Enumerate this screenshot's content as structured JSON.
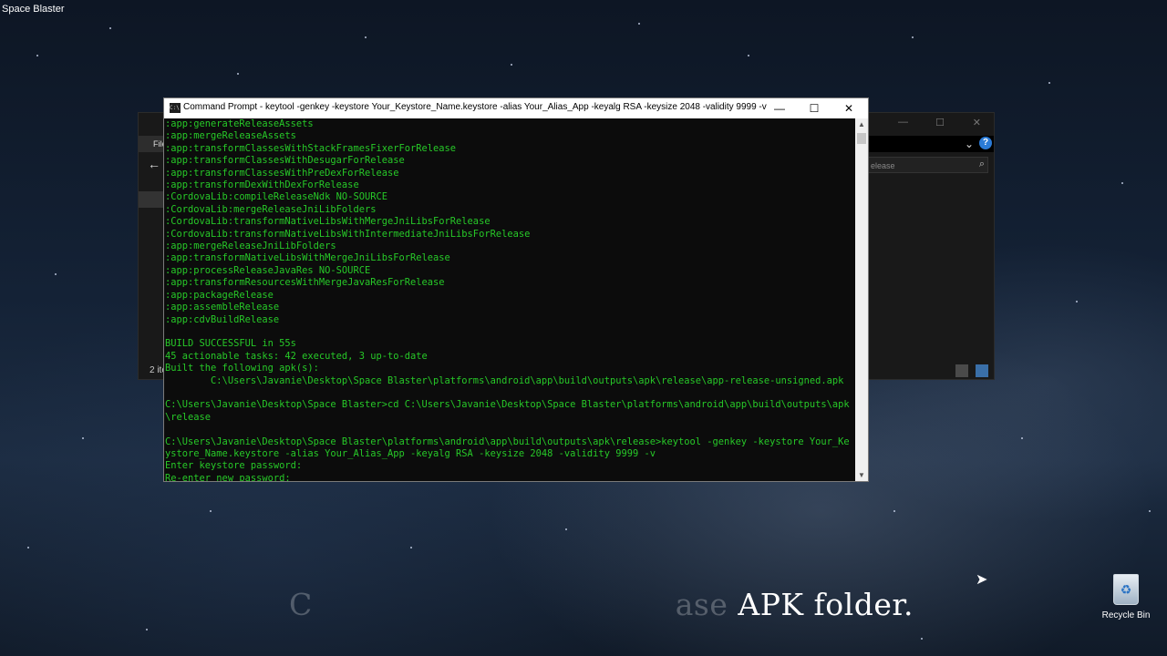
{
  "desktop": {
    "title": "Space Blaster",
    "recycle_bin_label": "Recycle Bin",
    "caption_faded_left": "C",
    "caption_faded_right": "ase",
    "caption_main": " APK folder."
  },
  "explorer": {
    "file_tab": "File",
    "search_placeholder": "elease",
    "status_text": "2 ite",
    "help_label": "?"
  },
  "cmd": {
    "title": "Command Prompt - keytool  -genkey -keystore Your_Keystore_Name.keystore -alias Your_Alias_App -keyalg RSA -keysize 2048 -validity 9999 -v",
    "lines": [
      ":app:generateReleaseAssets",
      ":app:mergeReleaseAssets",
      ":app:transformClassesWithStackFramesFixerForRelease",
      ":app:transformClassesWithDesugarForRelease",
      ":app:transformClassesWithPreDexForRelease",
      ":app:transformDexWithDexForRelease",
      ":CordovaLib:compileReleaseNdk NO-SOURCE",
      ":CordovaLib:mergeReleaseJniLibFolders",
      ":CordovaLib:transformNativeLibsWithMergeJniLibsForRelease",
      ":CordovaLib:transformNativeLibsWithIntermediateJniLibsForRelease",
      ":app:mergeReleaseJniLibFolders",
      ":app:transformNativeLibsWithMergeJniLibsForRelease",
      ":app:processReleaseJavaRes NO-SOURCE",
      ":app:transformResourcesWithMergeJavaResForRelease",
      ":app:packageRelease",
      ":app:assembleRelease",
      ":app:cdvBuildRelease",
      "",
      "BUILD SUCCESSFUL in 55s",
      "45 actionable tasks: 42 executed, 3 up-to-date",
      "Built the following apk(s):",
      "        C:\\Users\\Javanie\\Desktop\\Space Blaster\\platforms\\android\\app\\build\\outputs\\apk\\release\\app-release-unsigned.apk",
      "",
      "C:\\Users\\Javanie\\Desktop\\Space Blaster>cd C:\\Users\\Javanie\\Desktop\\Space Blaster\\platforms\\android\\app\\build\\outputs\\apk",
      "\\release",
      "",
      "C:\\Users\\Javanie\\Desktop\\Space Blaster\\platforms\\android\\app\\build\\outputs\\apk\\release>keytool -genkey -keystore Your_Ke",
      "ystore_Name.keystore -alias Your_Alias_App -keyalg RSA -keysize 2048 -validity 9999 -v",
      "Enter keystore password:",
      "Re-enter new password: "
    ]
  }
}
